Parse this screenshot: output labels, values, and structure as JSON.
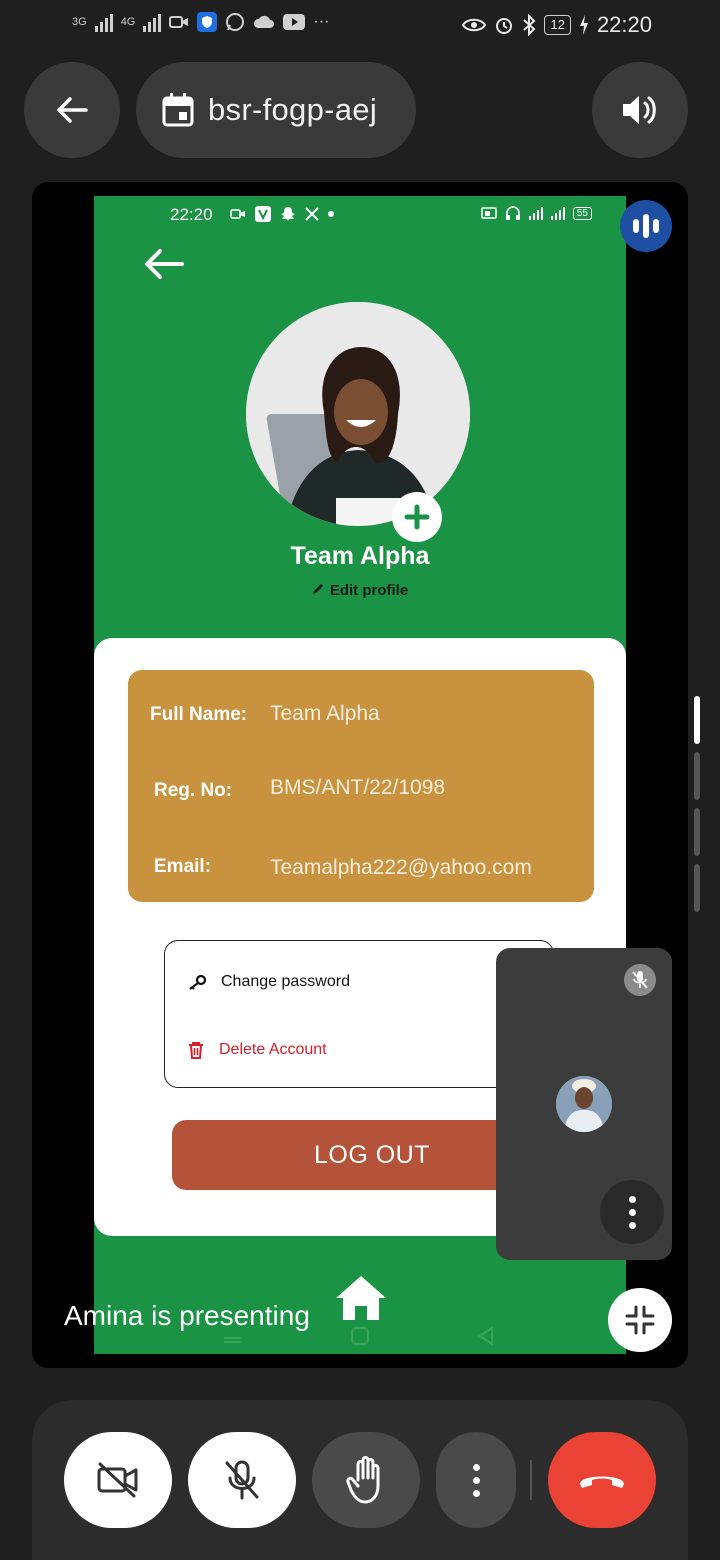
{
  "status_bar": {
    "network_1": "3G",
    "network_2": "4G",
    "battery": "12",
    "time": "22:20",
    "more": "···"
  },
  "top": {
    "meeting_code": "bsr-fogp-aej",
    "icons": [
      "back-arrow-icon",
      "calendar-icon",
      "speaker-icon"
    ]
  },
  "shared_screen": {
    "status_bar": {
      "time": "22:20",
      "battery": "55"
    },
    "profile": {
      "name": "Team Alpha",
      "edit_label": "Edit profile"
    },
    "info": {
      "full_name_label": "Full Name:",
      "full_name_value": "Team Alpha",
      "reg_label": "Reg. No:",
      "reg_value": "BMS/ANT/22/1098",
      "email_label": "Email:",
      "email_value": "Teamalpha222@yahoo.com"
    },
    "options": {
      "change_password": "Change password",
      "delete_account": "Delete Account"
    },
    "logout_label": "LOG OUT"
  },
  "presenter_text": "Amina is presenting",
  "colors": {
    "app_green": "#1a9444",
    "info_card": "#c8923e",
    "logout": "#b5533a",
    "delete_red": "#d4202a",
    "end_call": "#ea4335",
    "speaking_badge": "#1e4fa3"
  }
}
